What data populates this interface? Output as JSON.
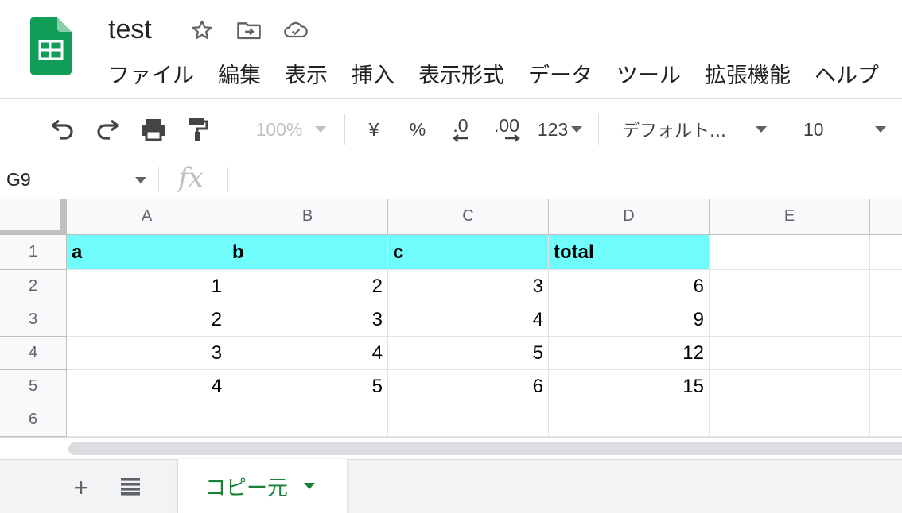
{
  "doc": {
    "title": "test",
    "icons": [
      "star-icon",
      "move-to-folder-icon",
      "cloud-saved-icon"
    ]
  },
  "colors": {
    "sheets_green": "#0f9d58",
    "header_fill": "#71fcfc",
    "tab_text": "#188038"
  },
  "menu": [
    "ファイル",
    "編集",
    "表示",
    "挿入",
    "表示形式",
    "データ",
    "ツール",
    "拡張機能",
    "ヘルプ"
  ],
  "toolbar": {
    "zoom": "100%",
    "currency": "¥",
    "percent": "%",
    "decrease_decimal": ".0",
    "increase_decimal": ".00",
    "more_formats": "123",
    "font": "デフォルト...",
    "font_size": "10"
  },
  "formula_bar": {
    "cell_ref": "G9",
    "fx": "fx",
    "value": ""
  },
  "grid": {
    "columns": [
      "A",
      "B",
      "C",
      "D",
      "E"
    ],
    "rows": [
      "1",
      "2",
      "3",
      "4",
      "5",
      "6"
    ],
    "cells": [
      [
        "a",
        "b",
        "c",
        "total",
        ""
      ],
      [
        "1",
        "2",
        "3",
        "6",
        ""
      ],
      [
        "2",
        "3",
        "4",
        "9",
        ""
      ],
      [
        "3",
        "4",
        "5",
        "12",
        ""
      ],
      [
        "4",
        "5",
        "6",
        "15",
        ""
      ],
      [
        "",
        "",
        "",
        "",
        ""
      ]
    ]
  },
  "sheets": {
    "add_label": "+",
    "tabs": [
      {
        "name": "コピー元",
        "active": true
      }
    ]
  }
}
